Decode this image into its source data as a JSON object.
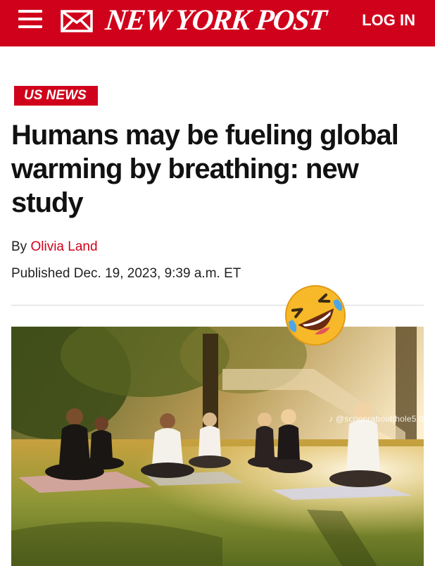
{
  "header": {
    "logo_text": "NEW YORK POST",
    "login_label": "LOG IN",
    "icons": [
      "hamburger-menu-icon",
      "mail-icon"
    ],
    "brand_color": "#d0021b"
  },
  "article": {
    "section": "US NEWS",
    "headline": "Humans may be fueling global warming by breathing: new study",
    "byline_prefix": "By",
    "author": "Olivia Land",
    "published": "Published Dec. 19, 2023, 9:39 a.m. ET"
  },
  "overlay": {
    "emoji_name": "rolling-on-floor-laughing-emoji",
    "watermark": "♪ @scrionraboutthole5.0"
  },
  "image": {
    "subject": "outdoor-yoga-meditation-photo"
  }
}
